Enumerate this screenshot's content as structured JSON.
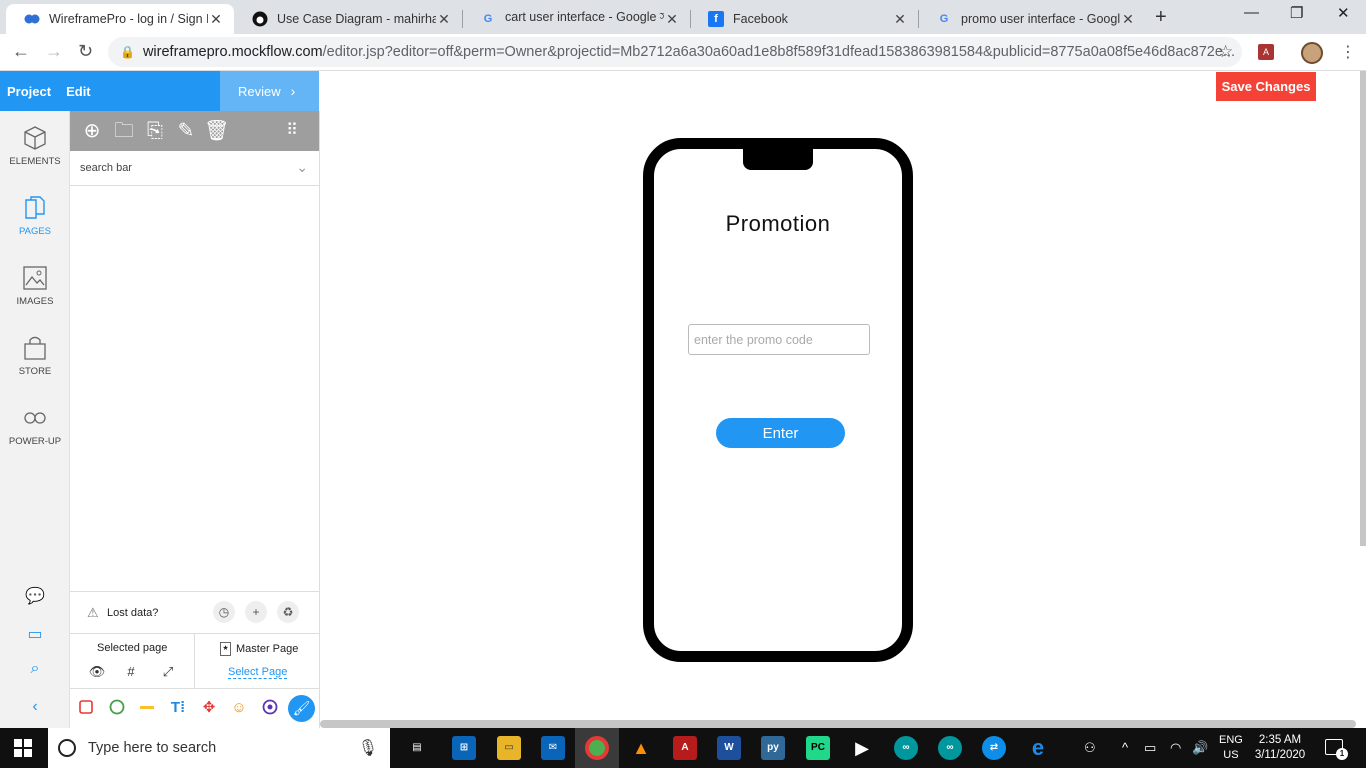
{
  "browser": {
    "tabs": [
      {
        "title": "WireframePro - log in / Sign In",
        "favicon": "mockflow-icon"
      },
      {
        "title": "Use Case Diagram - mahirhasan",
        "favicon": "github-icon"
      },
      {
        "title": "cart user interface - Google সা",
        "favicon": "google-icon"
      },
      {
        "title": "Facebook",
        "favicon": "facebook-icon"
      },
      {
        "title": "promo user interface - Google",
        "favicon": "google-icon"
      }
    ],
    "url_host": "wireframepro.mockflow.com",
    "url_path": "/editor.jsp?editor=off&perm=Owner&projectid=Mb2712a6a30a60ad1e8b8f589f31dfead1583863981584&publicid=8775a0a08f5e46d8ac872e..."
  },
  "app": {
    "menu": {
      "project": "Project",
      "edit": "Edit"
    },
    "review": "Review",
    "save_changes": "Save Changes",
    "rail": [
      {
        "label": "ELEMENTS",
        "icon": "cube-icon"
      },
      {
        "label": "PAGES",
        "icon": "pages-icon"
      },
      {
        "label": "IMAGES",
        "icon": "image-icon"
      },
      {
        "label": "STORE",
        "icon": "bag-icon"
      },
      {
        "label": "POWER-UP",
        "icon": "infinity-icon"
      }
    ],
    "panel": {
      "search_text": "search bar",
      "lost_data": "Lost data?",
      "selected_page": "Selected page",
      "master_page": "Master Page",
      "select_page": "Select Page"
    }
  },
  "wireframe": {
    "title": "Promotion",
    "input_placeholder": "enter the promo code",
    "button_label": "Enter"
  },
  "taskbar": {
    "search_placeholder": "Type here to search",
    "lang": "ENG",
    "region": "US",
    "time": "2:35 AM",
    "date": "3/11/2020",
    "notification_count": "1"
  },
  "colors": {
    "accent": "#2196f3",
    "accent_light": "#64b5f6",
    "save_red": "#f44336"
  }
}
